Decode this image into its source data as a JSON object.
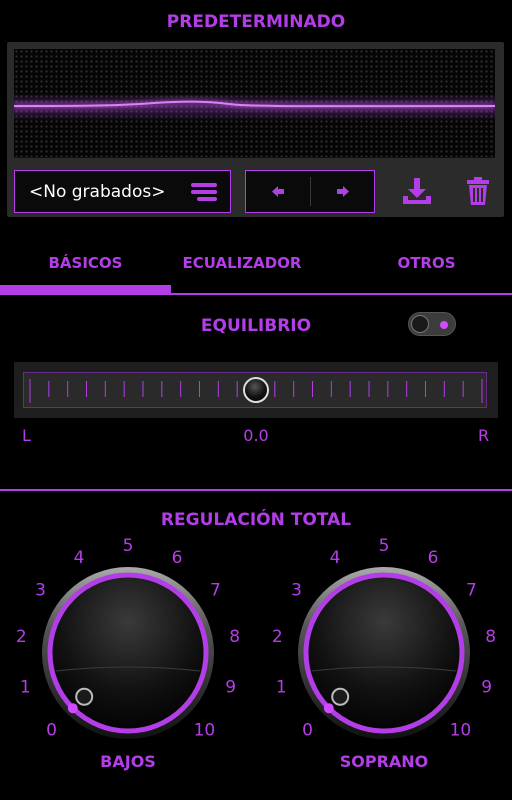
{
  "preset_title": "PREDETERMINADO",
  "preset": {
    "name": "<No grabados>",
    "list_icon": "list-icon",
    "prev_icon": "arrow-left-icon",
    "next_icon": "arrow-right-icon",
    "download_icon": "download-icon",
    "delete_icon": "trash-icon"
  },
  "tabs": [
    {
      "label": "BÁSICOS",
      "active": true
    },
    {
      "label": "ECUALIZADOR",
      "active": false
    },
    {
      "label": "OTROS",
      "active": false
    }
  ],
  "balance": {
    "title": "EQUILIBRIO",
    "enabled": true,
    "left_label": "L",
    "right_label": "R",
    "value": "0.0"
  },
  "master": {
    "title": "REGULACIÓN TOTAL",
    "knobs": [
      {
        "label": "BAJOS",
        "scale": [
          "0",
          "1",
          "2",
          "3",
          "4",
          "5",
          "6",
          "7",
          "8",
          "9",
          "10"
        ],
        "value": 0
      },
      {
        "label": "SOPRANO",
        "scale": [
          "0",
          "1",
          "2",
          "3",
          "4",
          "5",
          "6",
          "7",
          "8",
          "9",
          "10"
        ],
        "value": 0
      }
    ]
  },
  "colors": {
    "accent": "#b33ee8",
    "background": "#000000",
    "panel": "#2b2b2b"
  }
}
